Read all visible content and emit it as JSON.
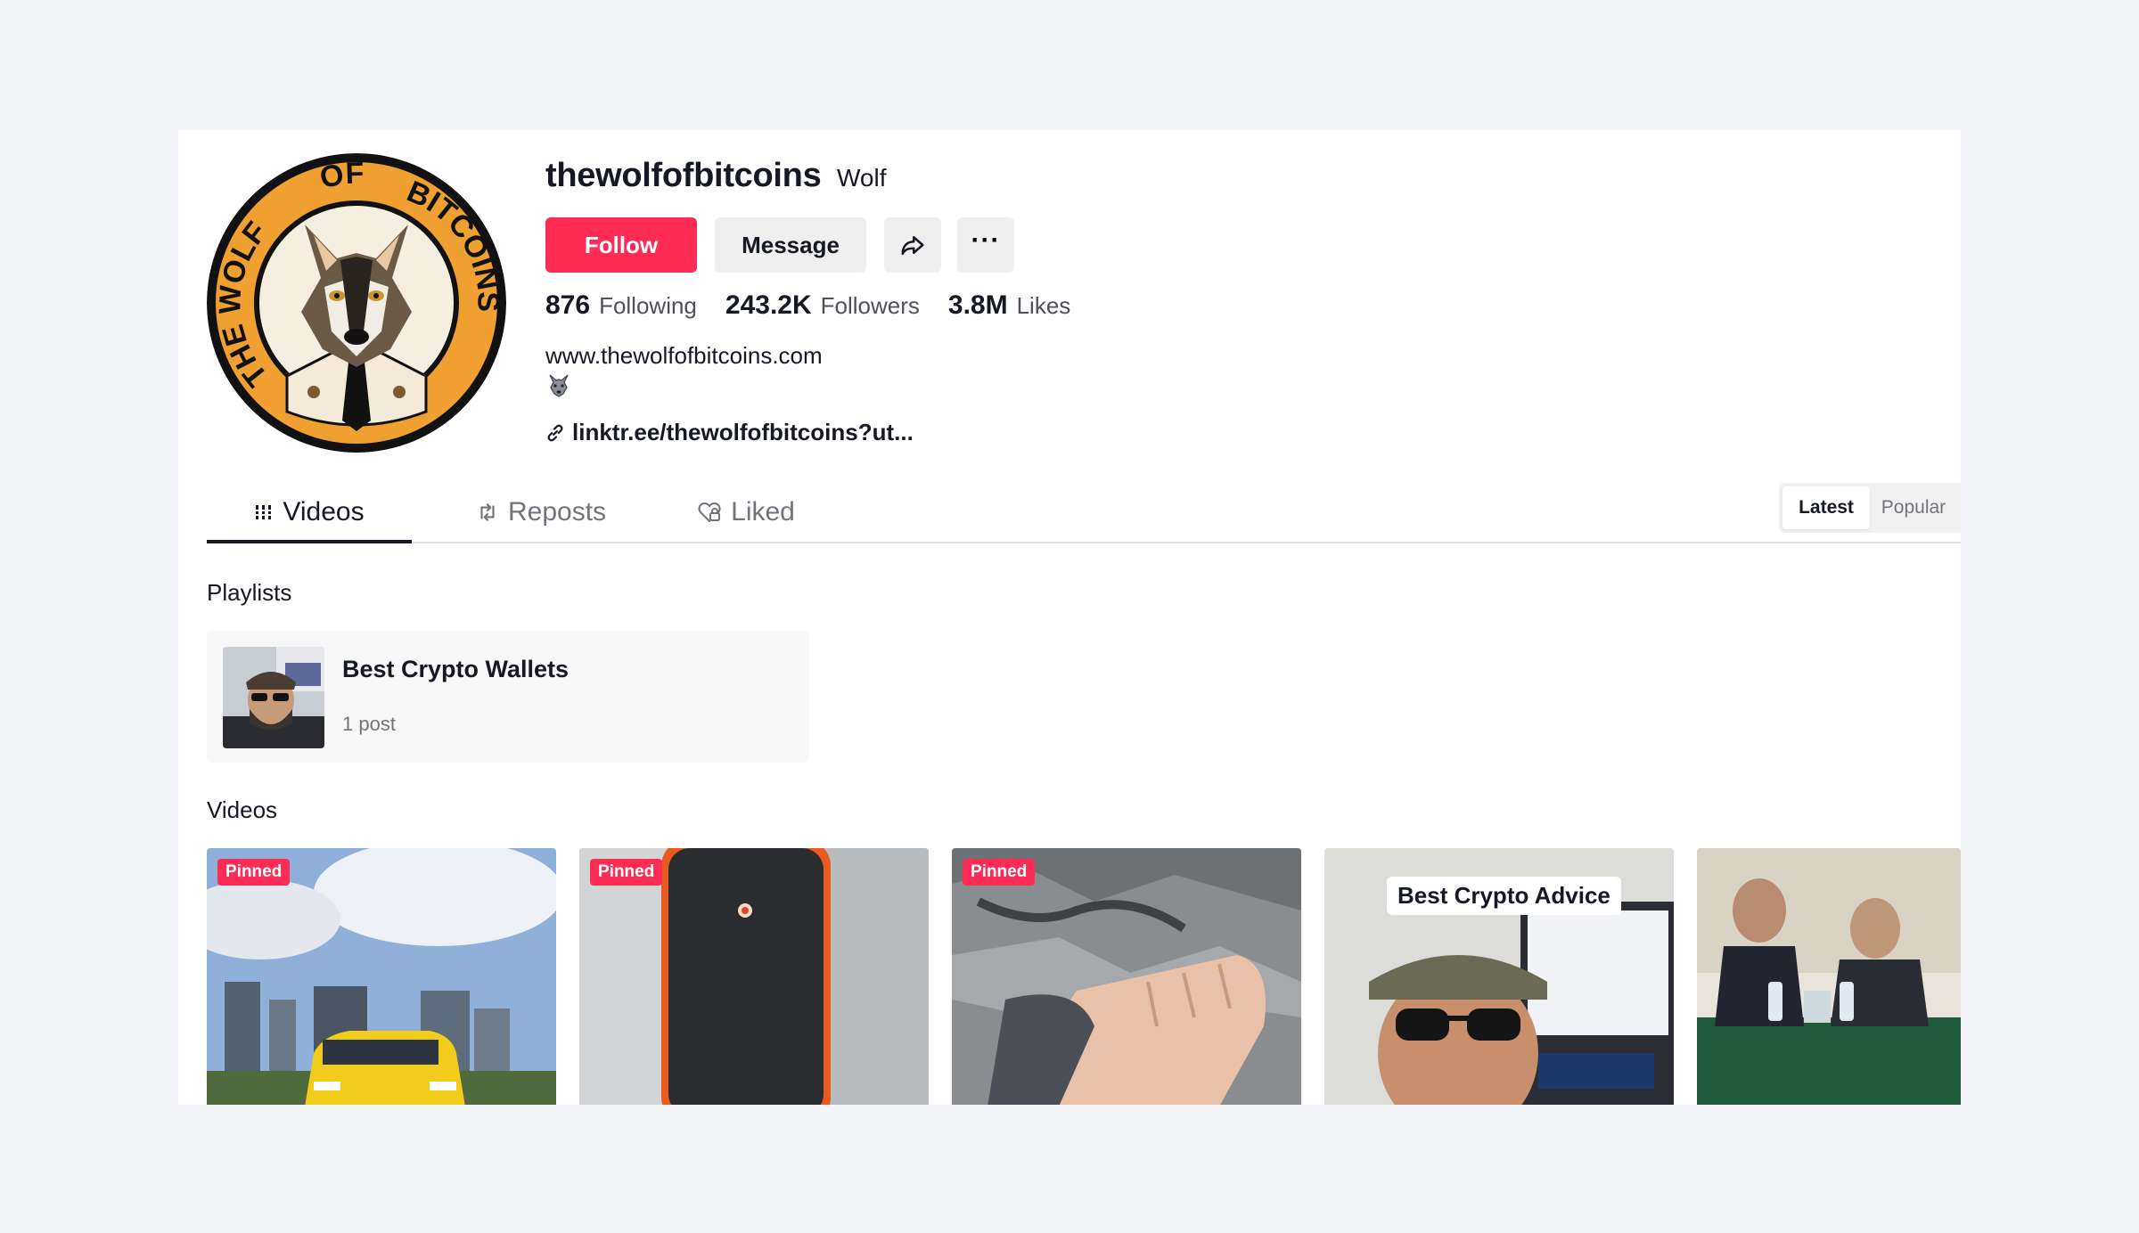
{
  "profile": {
    "username": "thewolfofbitcoins",
    "nickname": "Wolf",
    "avatar_text_left": "THE WOLF",
    "avatar_text_top": "OF",
    "avatar_text_right": "BITCOINS"
  },
  "actions": {
    "follow_label": "Follow",
    "message_label": "Message",
    "share_icon": "share-icon",
    "more_label": "···"
  },
  "stats": {
    "following": {
      "value": "876",
      "label": "Following"
    },
    "followers": {
      "value": "243.2K",
      "label": "Followers"
    },
    "likes": {
      "value": "3.8M",
      "label": "Likes"
    }
  },
  "bio": {
    "line1": "www.thewolfofbitcoins.com",
    "emoji_icon": "wolf-emoji-icon",
    "link": "linktr.ee/thewolfofbitcoins?ut..."
  },
  "tabs": [
    {
      "label": "Videos",
      "icon": "grid-icon",
      "active": true
    },
    {
      "label": "Reposts",
      "icon": "repost-icon",
      "active": false
    },
    {
      "label": "Liked",
      "icon": "heart-lock-icon",
      "active": false
    }
  ],
  "sort": {
    "options": [
      "Latest",
      "Popular"
    ],
    "selected": "Latest"
  },
  "playlists": {
    "title": "Playlists",
    "items": [
      {
        "name": "Best Crypto Wallets",
        "count": "1 post"
      }
    ]
  },
  "videos": {
    "title": "Videos",
    "items": [
      {
        "pinned_label": "Pinned",
        "overlay": ""
      },
      {
        "pinned_label": "Pinned",
        "overlay": ""
      },
      {
        "pinned_label": "Pinned",
        "overlay": ""
      },
      {
        "pinned_label": "",
        "overlay": "Best Crypto Advice"
      },
      {
        "pinned_label": "",
        "overlay": ""
      }
    ]
  },
  "colors": {
    "accent": "#fe2c55",
    "background": "#f4f5f8",
    "text": "#161823",
    "muted": "#73747b"
  }
}
